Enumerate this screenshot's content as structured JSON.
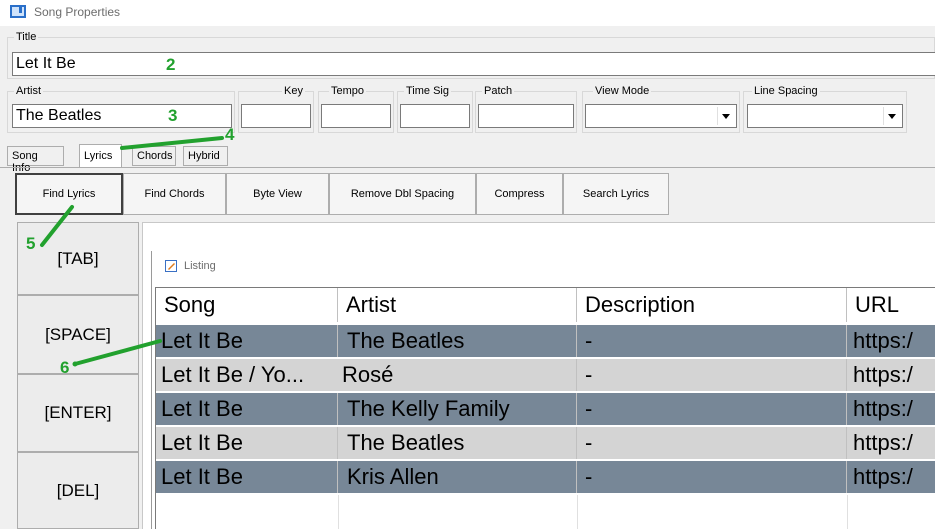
{
  "window": {
    "title": "Song Properties"
  },
  "title_group": {
    "label": "Title",
    "value": "Let It Be"
  },
  "artist_group": {
    "label": "Artist",
    "value": "The Beatles"
  },
  "key_group": {
    "label": "Key",
    "value": ""
  },
  "tempo_group": {
    "label": "Tempo",
    "value": ""
  },
  "timesig_group": {
    "label": "Time Sig",
    "value": ""
  },
  "patch_group": {
    "label": "Patch",
    "value": ""
  },
  "viewmode_group": {
    "label": "View Mode",
    "value": ""
  },
  "linespacing_group": {
    "label": "Line Spacing",
    "value": ""
  },
  "tabs": [
    {
      "label": "Song Info"
    },
    {
      "label": "Lyrics"
    },
    {
      "label": "Chords"
    },
    {
      "label": "Hybrid"
    }
  ],
  "toolbar": [
    {
      "label": "Find Lyrics"
    },
    {
      "label": "Find Chords"
    },
    {
      "label": "Byte View"
    },
    {
      "label": "Remove Dbl Spacing"
    },
    {
      "label": "Compress"
    },
    {
      "label": "Search Lyrics"
    }
  ],
  "side_keys": [
    {
      "label": "[TAB]"
    },
    {
      "label": "[SPACE]"
    },
    {
      "label": "[ENTER]"
    },
    {
      "label": "[DEL]"
    }
  ],
  "listing": {
    "title": "Listing",
    "columns": [
      "Song",
      "Artist",
      "Description",
      "URL"
    ],
    "rows": [
      [
        "Let It Be",
        "The Beatles",
        "-",
        "https:/"
      ],
      [
        "Let It Be / Yo...",
        "Rosé",
        "-",
        "https:/"
      ],
      [
        "Let It Be",
        "The Kelly Family",
        "-",
        "https:/"
      ],
      [
        "Let It Be",
        "The Beatles",
        "-",
        "https:/"
      ],
      [
        "Let It Be",
        "Kris Allen",
        "-",
        "https:/"
      ]
    ]
  },
  "annotations": [
    "2",
    "3",
    "4",
    "5",
    "6"
  ],
  "colors": {
    "annotation": "#22a12e",
    "row_dark": "#778797",
    "row_light": "#d4d4d4"
  }
}
